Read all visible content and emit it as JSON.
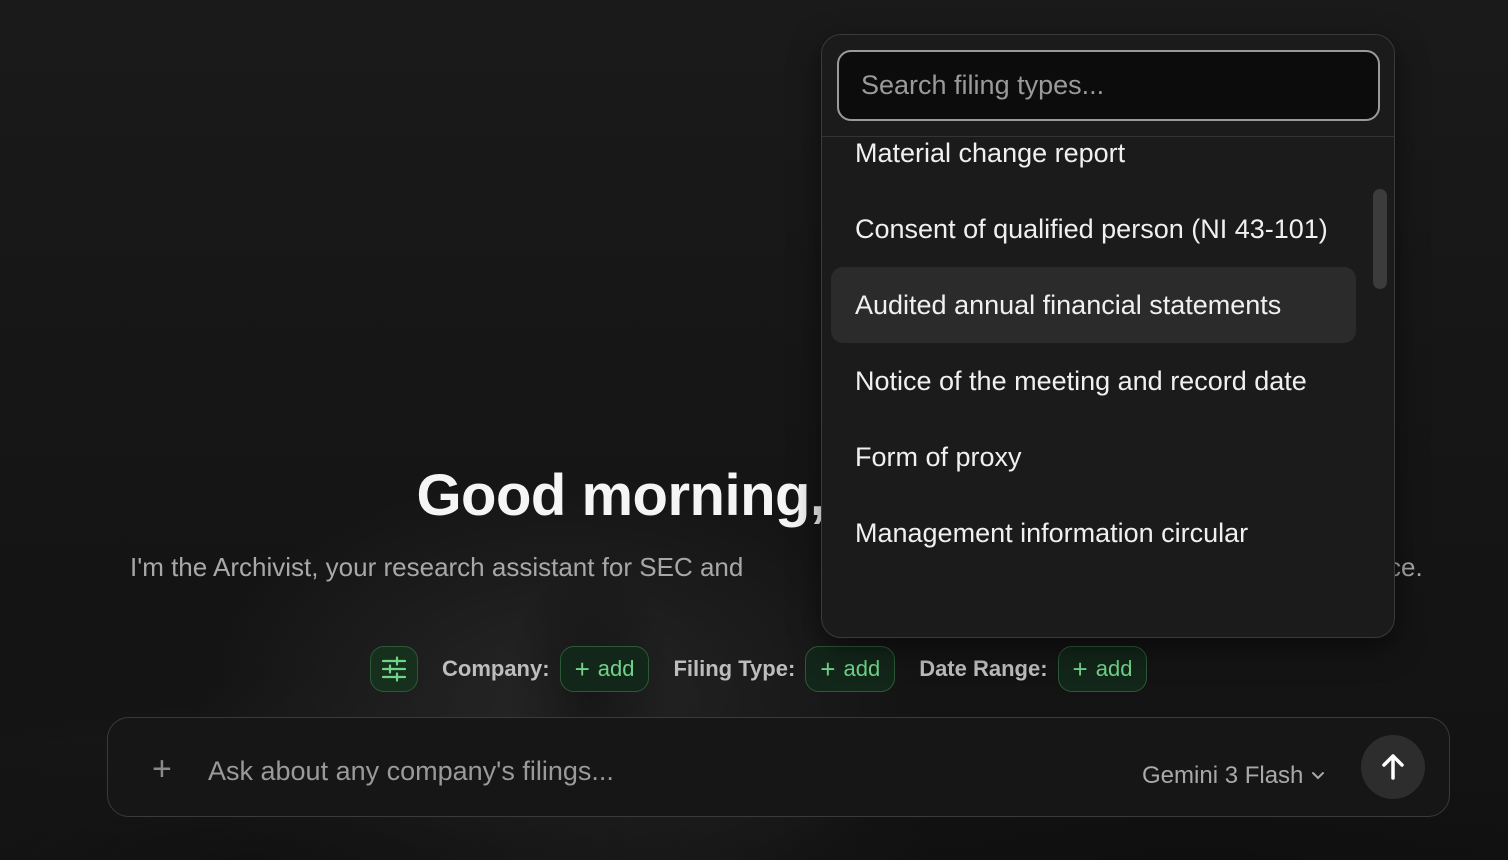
{
  "main": {
    "greeting": "Good morning,",
    "subtitle_left": "I'm the Archivist, your research assistant for SEC and",
    "subtitle_right": "ce."
  },
  "filters": {
    "company_label": "Company:",
    "filing_type_label": "Filing Type:",
    "date_range_label": "Date Range:",
    "add_label": "add"
  },
  "composer": {
    "placeholder": "Ask about any company's filings...",
    "model": "Gemini 3 Flash"
  },
  "dropdown": {
    "search_placeholder": "Search filing types...",
    "items": [
      {
        "label": "Material change report",
        "active": false
      },
      {
        "label": "Consent of qualified person (NI 43-101)",
        "active": false
      },
      {
        "label": "Audited annual financial statements",
        "active": true
      },
      {
        "label": "Notice of the meeting and record date",
        "active": false
      },
      {
        "label": "Form of proxy",
        "active": false
      },
      {
        "label": "Management information circular",
        "active": false
      }
    ]
  },
  "colors": {
    "accent_green": "#6fd488",
    "chip_bg": "#13261a"
  }
}
